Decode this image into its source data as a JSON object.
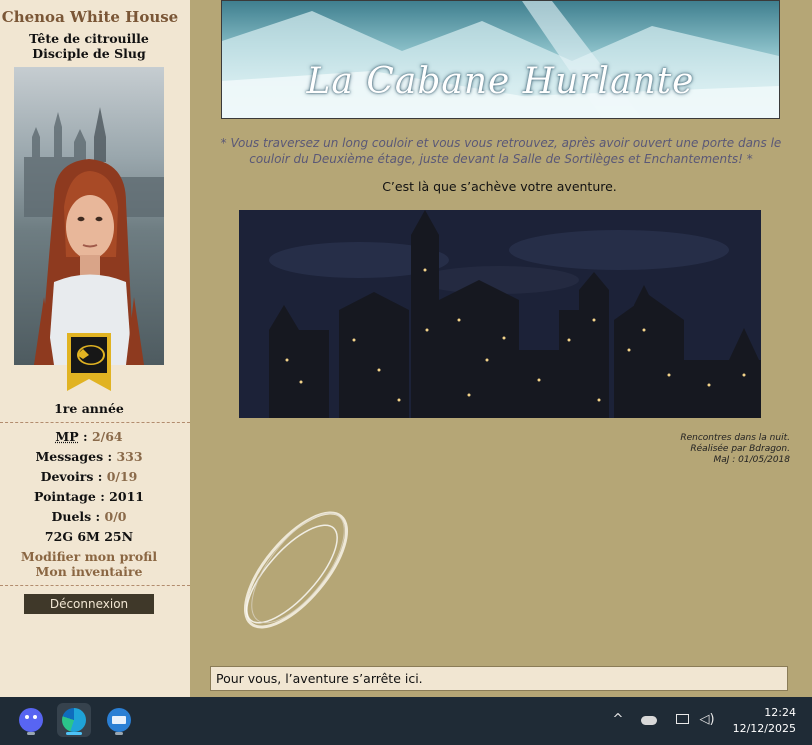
{
  "profile": {
    "name": "Chenoa White House",
    "rank_line1": "Tête de citrouille",
    "rank_line2": "Disciple de Slug",
    "year": "1re année",
    "stats": {
      "mp_label": "MP",
      "mp_value": "2/64",
      "messages_label": "Messages",
      "messages_value": "333",
      "devoirs_label": "Devoirs",
      "devoirs_value": "0/19",
      "pointage_label": "Pointage",
      "pointage_value": "2011",
      "duels_label": "Duels",
      "duels_value": "0/0",
      "currency": "72G 6M 25N"
    },
    "links": {
      "edit_profile": "Modifier mon profil",
      "inventory": "Mon inventaire"
    },
    "logout_label": "Déconnexion"
  },
  "main": {
    "banner_title": "La Cabane Hurlante",
    "narration": "* Vous traversez un long couloir et vous vous retrouvez, après avoir ouvert une porte dans le couloir du Deuxième étage, juste devant la Salle de Sortilèges et Enchantements! *",
    "ending_text": "C’est là que s’achève votre aventure.",
    "credits": {
      "line1": "Rencontres dans la nuit.",
      "line2": "Réalisée par Bdragon.",
      "line3": "MaJ : 01/05/2018"
    },
    "message": "Pour vous, l’aventure s’arrête ici."
  },
  "taskbar": {
    "apps": [
      {
        "icon": "discord-icon",
        "color": "#5865f2"
      },
      {
        "icon": "edge-icon",
        "color": "#1fa3d8"
      },
      {
        "icon": "thunderbird-icon",
        "color": "#2a7fd4"
      }
    ],
    "tray_icons": [
      "chevron-up-icon",
      "onedrive-icon",
      "network-icon",
      "volume-icon"
    ],
    "time": "12:24",
    "date": "12/12/2025"
  },
  "colors": {
    "page_background": "#b5a676",
    "sidebar_background": "#f1e6d2",
    "stat_value": "#8a6a4a",
    "taskbar": "#1f2b36",
    "narration_text": "#5a5877"
  }
}
